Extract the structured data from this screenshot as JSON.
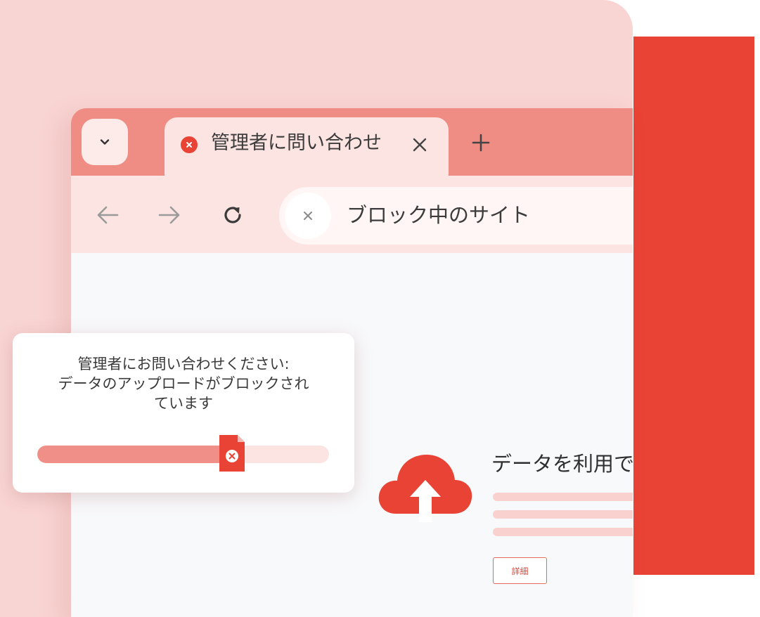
{
  "colors": {
    "accent_red": "#e84335",
    "tabbar": "#ef8d85",
    "toolbar": "#fce4e2",
    "background_pink": "#f8d4d2",
    "content_bg": "#f8f9fb"
  },
  "tabbar": {
    "dropdown_icon": "chevron-down-icon",
    "active_tab": {
      "favicon": "error-circle-icon",
      "title": "管理者に問い合わせ",
      "close_icon": "close-icon"
    },
    "new_tab_icon": "plus-icon"
  },
  "toolbar": {
    "back_icon": "arrow-left-icon",
    "forward_icon": "arrow-right-icon",
    "reload_icon": "reload-icon",
    "omnibox": {
      "clear_icon": "close-icon",
      "text": "ブロック中のサイト"
    }
  },
  "page": {
    "icon": "cloud-upload-icon",
    "heading": "データを利用で",
    "details_button": "詳細"
  },
  "popup": {
    "message": "管理者にお問い合わせください:\nデータのアップロードがブロックされ\nています",
    "progress": 0.65,
    "file_icon": "blocked-file-icon"
  }
}
